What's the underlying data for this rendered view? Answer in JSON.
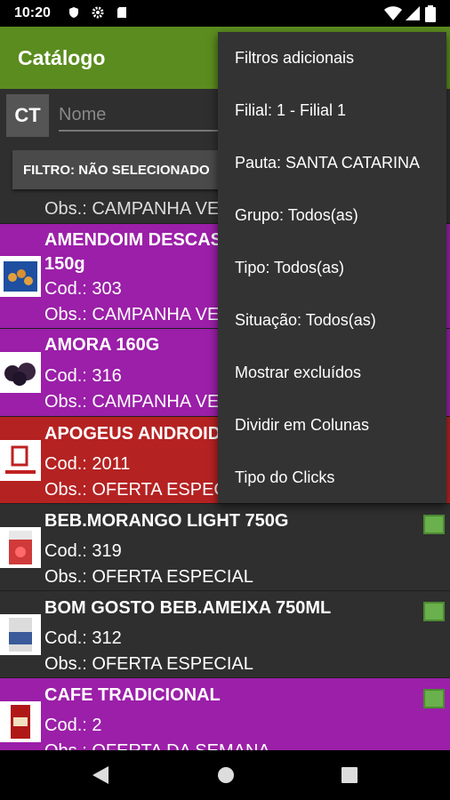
{
  "status_bar": {
    "time": "10:20"
  },
  "app_bar": {
    "title": "Catálogo"
  },
  "search": {
    "code_button": "CT",
    "placeholder": "Nome"
  },
  "filter": {
    "label": "FILTRO: NÃO SELECIONADO"
  },
  "colors": {
    "accent_green": "#5b8c1f",
    "purple": "#9b1fa8",
    "red": "#b52222",
    "dark": "#2f2f2f",
    "check_green": "#6ab04c"
  },
  "catalog": {
    "partial_top": {
      "obs": "Obs.: CAMPANHA VERÃO"
    },
    "items": [
      {
        "name": "AMENDOIM DESCASCADO",
        "name2": "150g",
        "cod": "Cod.: 303",
        "obs": "Obs.: CAMPANHA VERÃO",
        "bg": "purple",
        "thumb": "peanuts-icon"
      },
      {
        "name": "AMORA 160G",
        "cod": "Cod.: 316",
        "obs": "Obs.: CAMPANHA VERÃO",
        "bg": "purple",
        "thumb": "blackberry-icon"
      },
      {
        "name": "APOGEUS ANDROID",
        "cod": "Cod.: 2011",
        "obs": "Obs.: OFERTA ESPECIAL",
        "bg": "red",
        "thumb": "apogeus-logo"
      },
      {
        "name": "BEB.MORANGO LIGHT 750G",
        "cod": "Cod.: 319",
        "obs": "Obs.: OFERTA ESPECIAL",
        "bg": "dark",
        "thumb": "juice-box-icon",
        "checked": true
      },
      {
        "name": "BOM GOSTO BEB.AMEIXA 750ML",
        "cod": "Cod.: 312",
        "obs": "Obs.: OFERTA ESPECIAL",
        "bg": "dark",
        "thumb": "juice-box-icon",
        "checked": true
      },
      {
        "name": "CAFE TRADICIONAL",
        "cod": "Cod.: 2",
        "obs": "Obs.: OFERTA DA SEMANA",
        "bg": "purple",
        "thumb": "coffee-pack-icon",
        "checked": true
      }
    ]
  },
  "overflow_menu": {
    "items": [
      "Filtros adicionais",
      "Filial: 1 - Filial 1",
      "Pauta: SANTA CATARINA",
      "Grupo: Todos(as)",
      "Tipo: Todos(as)",
      "Situação: Todos(as)",
      "Mostrar excluídos",
      "Dividir em Colunas",
      "Tipo do Clicks"
    ]
  }
}
